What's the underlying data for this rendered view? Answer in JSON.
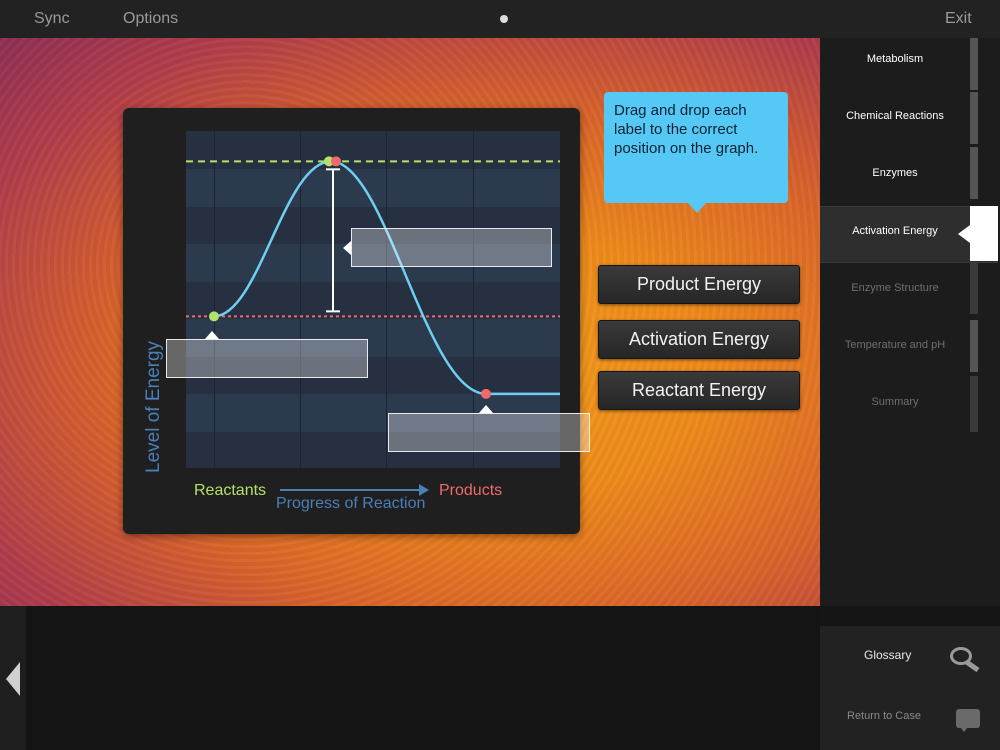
{
  "topbar": {
    "sync": "Sync",
    "options": "Options",
    "exit": "Exit"
  },
  "chart_data": {
    "type": "line",
    "ylabel": "Level of Energy",
    "xlabel": "Progress of Reaction",
    "x_start_label": "Reactants",
    "x_end_label": "Products",
    "reactant_level": 0.45,
    "peak_level": 0.91,
    "product_level": 0.22
  },
  "instruction": "Drag and drop each label to the correct position on the graph.",
  "labels": [
    "Product Energy",
    "Activation Energy",
    "Reactant Energy"
  ],
  "sidebar": {
    "items": [
      {
        "label": "Metabolism",
        "state": "complete"
      },
      {
        "label": "Chemical Reactions",
        "state": "complete"
      },
      {
        "label": "Enzymes",
        "state": "complete"
      },
      {
        "label": "Activation Energy",
        "state": "active"
      },
      {
        "label": "Enzyme Structure",
        "state": "locked"
      },
      {
        "label": "Temperature and pH",
        "state": "locked"
      },
      {
        "label": "Summary",
        "state": "locked"
      }
    ]
  },
  "bottom": {
    "glossary": "Glossary",
    "return_to_case": "Return to Case"
  },
  "colors": {
    "reactant_green": "#b5e06a",
    "product_red": "#f06a6a",
    "curve_blue": "#6ecff5",
    "bubble_blue": "#55c8f5"
  }
}
